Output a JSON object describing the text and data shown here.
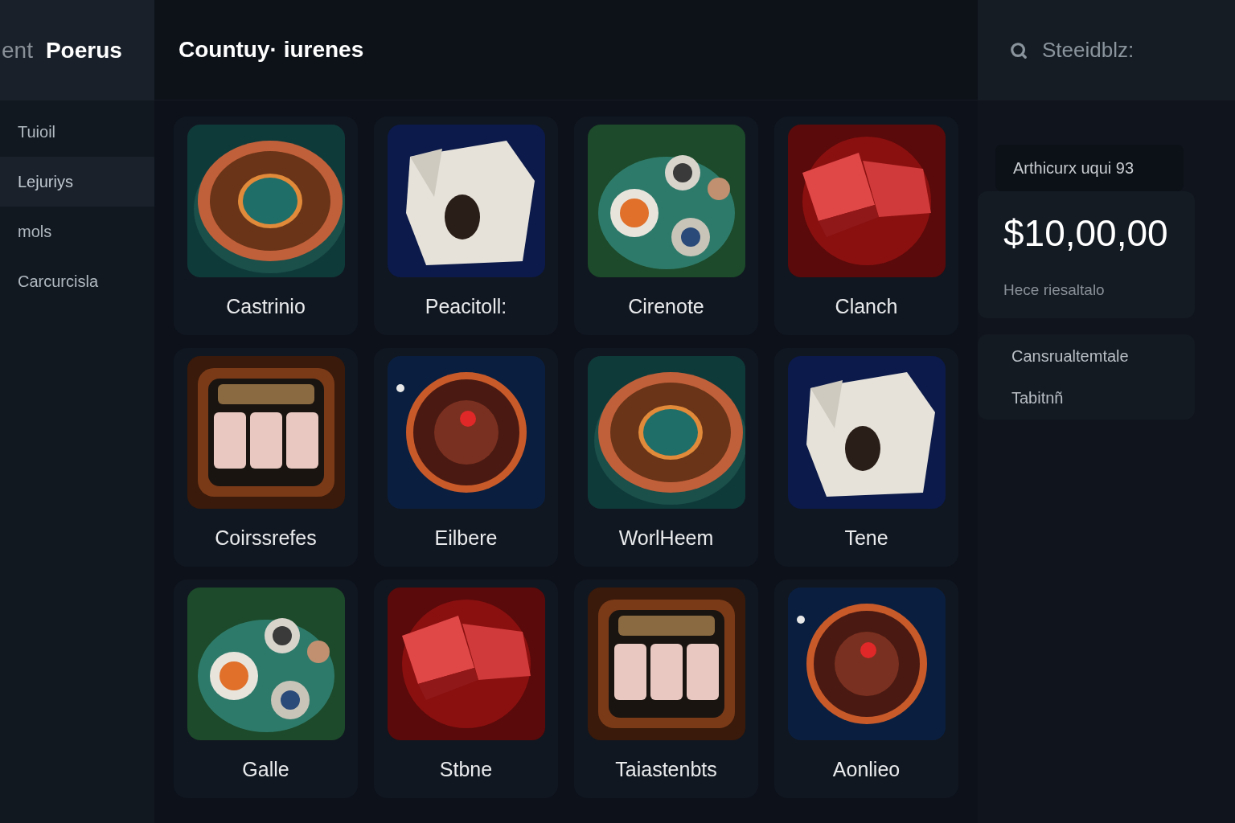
{
  "sidebar": {
    "title_prefix": "ent",
    "title": "Poerus",
    "items": [
      {
        "label": "Tuioil",
        "selected": false
      },
      {
        "label": "Lejuriys",
        "selected": true
      },
      {
        "label": "mols",
        "selected": false
      },
      {
        "label": "Carcurcisla",
        "selected": false
      }
    ]
  },
  "header": {
    "title": "Countuy· iurenes"
  },
  "games": [
    {
      "label": "Castrinio",
      "kind": "picture"
    },
    {
      "label": "Peacitoll:",
      "kind": "picture"
    },
    {
      "label": "Cirenote",
      "kind": "picture"
    },
    {
      "label": "Clanch",
      "kind": "picture"
    },
    {
      "label": "Coirssrefes",
      "kind": "picture"
    },
    {
      "label": "Eilbere",
      "kind": "picture"
    },
    {
      "label": "WorlHeem",
      "kind": "picture"
    },
    {
      "label": "Tene",
      "kind": "picture"
    },
    {
      "label": "Galle",
      "kind": "picture"
    },
    {
      "label": "Stbne",
      "kind": "picture"
    },
    {
      "label": "Taiastenbts",
      "kind": "picture"
    },
    {
      "label": "Aonlieo",
      "kind": "picture"
    }
  ],
  "search": {
    "placeholder": "Steeidblz:"
  },
  "balance": {
    "caption": "Arthicurx uqui 93",
    "amount": "$10,00,00",
    "note": "Hece riesaltalo"
  },
  "links": [
    "Cansrualtemtale",
    "Tabitnñ"
  ]
}
